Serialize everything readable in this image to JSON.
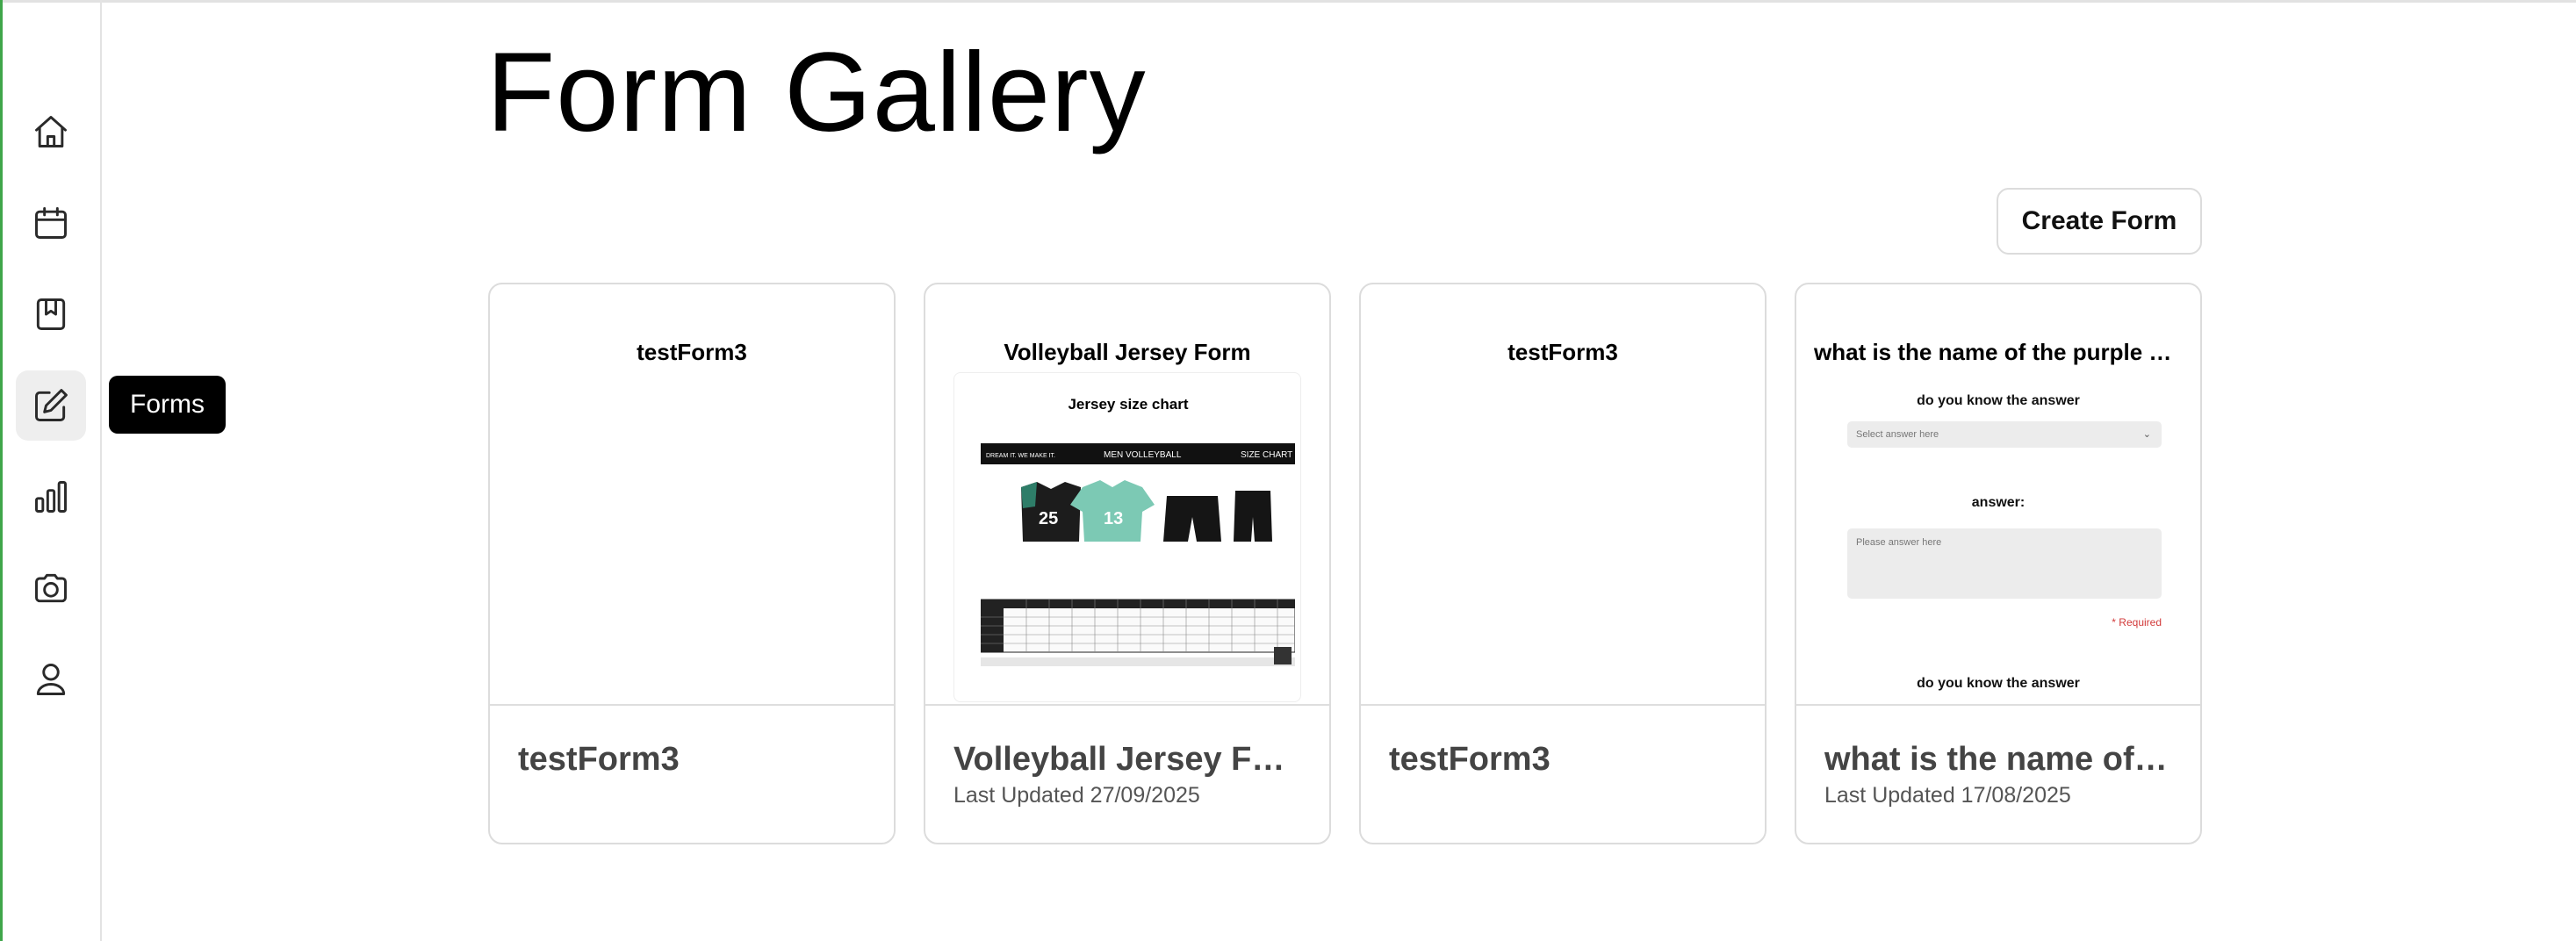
{
  "page": {
    "title": "Form Gallery"
  },
  "sidebar": {
    "items": [
      {
        "name": "home",
        "icon": "home-icon"
      },
      {
        "name": "calendar",
        "icon": "calendar-icon"
      },
      {
        "name": "bookmarks",
        "icon": "bookmark-icon"
      },
      {
        "name": "forms",
        "icon": "edit-icon",
        "active": true
      },
      {
        "name": "analytics",
        "icon": "bar-chart-icon"
      },
      {
        "name": "camera",
        "icon": "camera-icon"
      },
      {
        "name": "profile",
        "icon": "user-icon"
      }
    ],
    "tooltip": "Forms"
  },
  "toolbar": {
    "create_label": "Create Form"
  },
  "cards": [
    {
      "preview_title": "testForm3",
      "title": "testForm3",
      "updated": ""
    },
    {
      "preview_title": "Volleyball Jersey Form",
      "title": "Volleyball Jersey Form",
      "updated": "Last Updated 27/09/2025",
      "preview": {
        "caption": "Jersey size chart",
        "image_header_left": "DREAM IT. WE MAKE IT.",
        "image_header_center": "MEN VOLLEYBALL",
        "image_header_right": "SIZE CHART",
        "jersey_numbers": [
          "25",
          "13"
        ]
      }
    },
    {
      "preview_title": "testForm3",
      "title": "testForm3",
      "updated": ""
    },
    {
      "preview_title": "what is the name of the purple cr...",
      "title": "what is the name of t...",
      "updated": "Last Updated 17/08/2025",
      "preview": {
        "q1": "do you know the answer",
        "select_placeholder": "Select answer here",
        "q2": "answer:",
        "textarea_placeholder": "Please answer here",
        "required": "* Required",
        "q3": "do you know the answer"
      }
    }
  ],
  "colors": {
    "accent_green": "#3fa64a",
    "tooltip_bg": "#000000",
    "required_red": "#d23a3a"
  }
}
